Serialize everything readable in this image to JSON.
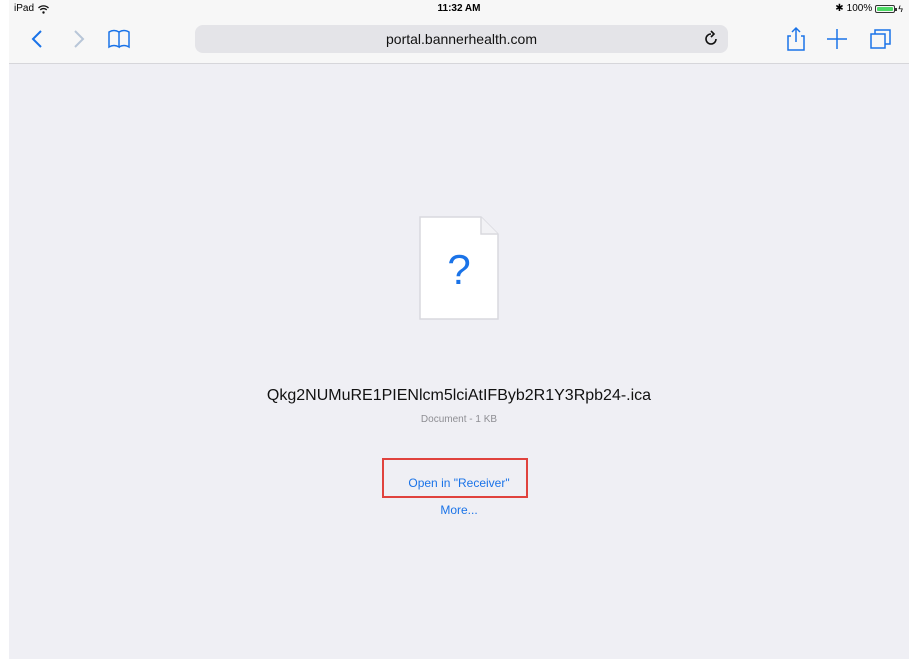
{
  "status_bar": {
    "device": "iPad",
    "time": "11:32 AM",
    "battery_percent": "100%",
    "wifi_icon": "wifi-icon",
    "bluetooth_icon": "bluetooth-icon",
    "battery_icon": "battery-icon",
    "battery_level": 1.0
  },
  "toolbar": {
    "url": "portal.bannerhealth.com",
    "icons": {
      "back": "chevron-left-icon",
      "forward": "chevron-right-icon",
      "bookmarks": "book-icon",
      "reload": "reload-icon",
      "share": "share-icon",
      "new_tab": "plus-icon",
      "tabs": "tabs-icon"
    }
  },
  "download": {
    "icon": "unknown-file-icon",
    "icon_glyph": "?",
    "filename": "Qkg2NUMuRE1PIENlcm5lciAtIFByb2R1Y3Rpb24-.ica",
    "meta": "Document - 1 KB",
    "open_in_label": "Open in \"Receiver\"",
    "more_label": "More..."
  },
  "colors": {
    "accent": "#1a73e8",
    "highlight_box": "#e0423d",
    "background": "#efeff4"
  }
}
